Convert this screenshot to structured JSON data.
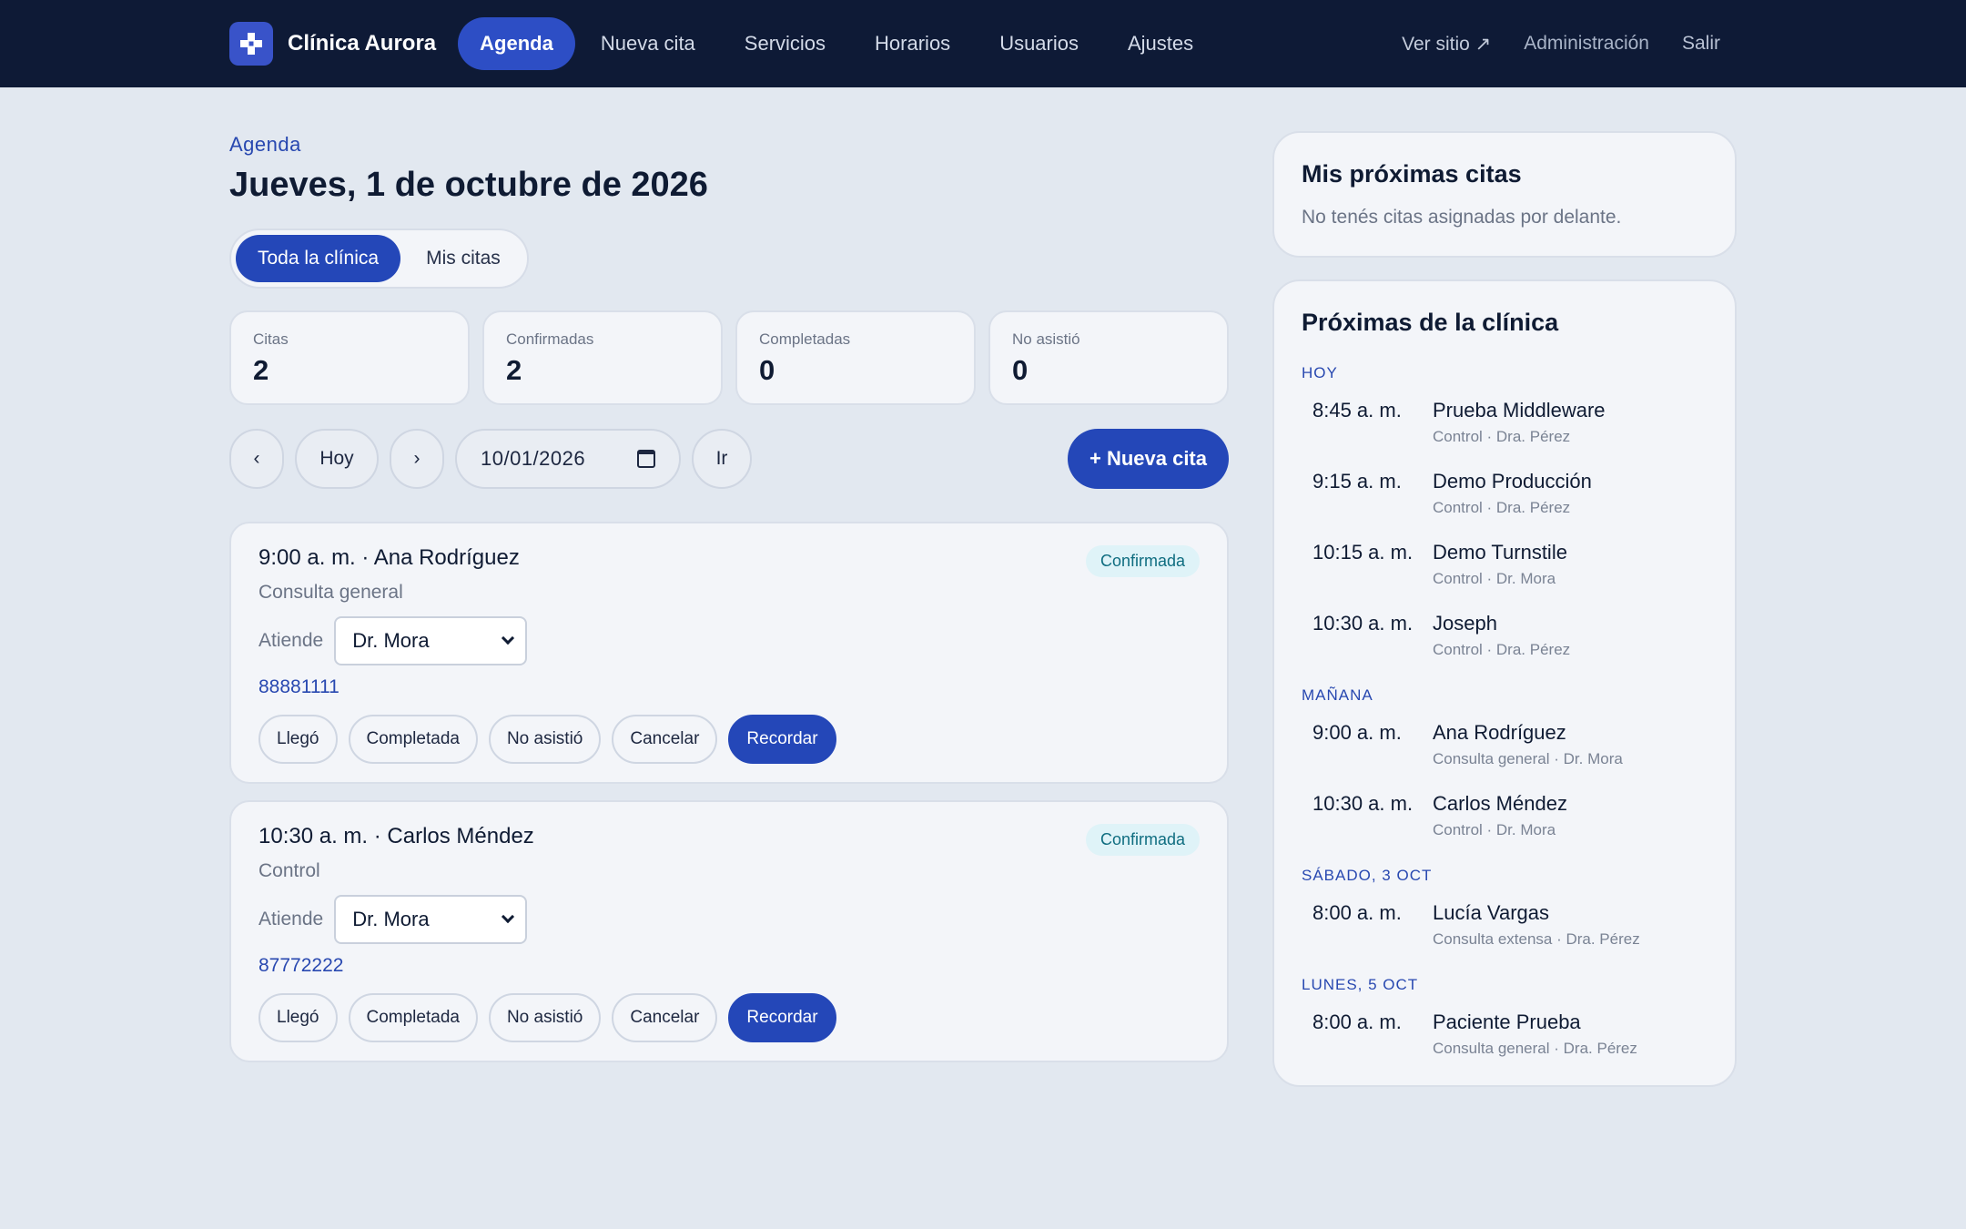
{
  "brand": {
    "name": "Clínica Aurora"
  },
  "nav": {
    "items": [
      "Agenda",
      "Nueva cita",
      "Servicios",
      "Horarios",
      "Usuarios",
      "Ajustes"
    ],
    "right": {
      "ver_sitio": "Ver sitio ↗",
      "admin": "Administración",
      "salir": "Salir"
    }
  },
  "header": {
    "crumb": "Agenda",
    "title": "Jueves, 1 de octubre de 2026"
  },
  "segment": {
    "all": "Toda la clínica",
    "mine": "Mis citas"
  },
  "stats": [
    {
      "label": "Citas",
      "value": "2"
    },
    {
      "label": "Confirmadas",
      "value": "2"
    },
    {
      "label": "Completadas",
      "value": "0"
    },
    {
      "label": "No asistió",
      "value": "0"
    }
  ],
  "toolbar": {
    "prev": "‹",
    "today": "Hoy",
    "next": "›",
    "date": "10/01/2026",
    "go": "Ir",
    "new": "+ Nueva cita"
  },
  "appointments": [
    {
      "title": "9:00 a. m. · Ana Rodríguez",
      "status": "Confirmada",
      "service": "Consulta general",
      "attend_label": "Atiende",
      "doctor": "Dr. Mora",
      "phone": "88881111",
      "actions": [
        "Llegó",
        "Completada",
        "No asistió",
        "Cancelar",
        "Recordar"
      ]
    },
    {
      "title": "10:30 a. m. · Carlos Méndez",
      "status": "Confirmada",
      "service": "Control",
      "attend_label": "Atiende",
      "doctor": "Dr. Mora",
      "phone": "87772222",
      "actions": [
        "Llegó",
        "Completada",
        "No asistió",
        "Cancelar",
        "Recordar"
      ]
    }
  ],
  "my_upcoming": {
    "title": "Mis próximas citas",
    "empty": "No tenés citas asignadas por delante."
  },
  "clinic_upcoming": {
    "title": "Próximas de la clínica",
    "days": [
      {
        "label": "HOY",
        "items": [
          {
            "time": "8:45 a. m.",
            "name": "Prueba Middleware",
            "meta": "Control · Dra. Pérez"
          },
          {
            "time": "9:15 a. m.",
            "name": "Demo Producción",
            "meta": "Control · Dra. Pérez"
          },
          {
            "time": "10:15 a. m.",
            "name": "Demo Turnstile",
            "meta": "Control · Dr. Mora"
          },
          {
            "time": "10:30 a. m.",
            "name": "Joseph",
            "meta": "Control · Dra. Pérez"
          }
        ]
      },
      {
        "label": "MAÑANA",
        "items": [
          {
            "time": "9:00 a. m.",
            "name": "Ana Rodríguez",
            "meta": "Consulta general · Dr. Mora"
          },
          {
            "time": "10:30 a. m.",
            "name": "Carlos Méndez",
            "meta": "Control · Dr. Mora"
          }
        ]
      },
      {
        "label": "SÁBADO, 3 OCT",
        "items": [
          {
            "time": "8:00 a. m.",
            "name": "Lucía Vargas",
            "meta": "Consulta extensa · Dra. Pérez"
          }
        ]
      },
      {
        "label": "LUNES, 5 OCT",
        "items": [
          {
            "time": "8:00 a. m.",
            "name": "Paciente Prueba",
            "meta": "Consulta general · Dra. Pérez"
          }
        ]
      }
    ]
  }
}
